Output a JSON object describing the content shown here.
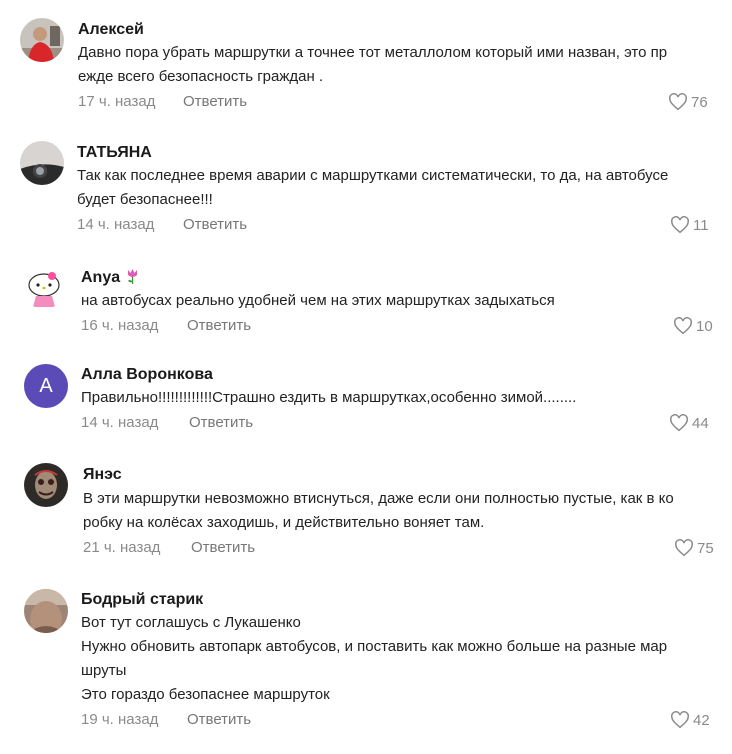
{
  "reply_label": "Ответить",
  "comments": [
    {
      "author": "Алексей",
      "lines": [
        "Давно пора убрать маршрутки а точнее тот металлолом который ими назван, это пр",
        "ежде всего безопасность граждан ."
      ],
      "time": "17 ч. назад",
      "likes": "76"
    },
    {
      "author": "ТАТЬЯНА",
      "lines": [
        "Так как последнее время аварии с маршрутками систематически, то да, на автобусе",
        "будет безопаснее!!!"
      ],
      "time": "14 ч. назад",
      "likes": "11"
    },
    {
      "author": "Anya",
      "lines": [
        "на автобусах реально удобней чем на этих маршрутках задыхаться"
      ],
      "time": "16 ч. назад",
      "likes": "10"
    },
    {
      "author": "Алла Воронкова",
      "avatar_letter": "A",
      "lines": [
        "Правильно!!!!!!!!!!!!!Страшно ездить в маршрутках,особенно зимой........"
      ],
      "time": "14 ч. назад",
      "likes": "44"
    },
    {
      "author": "Янэс",
      "lines": [
        "В эти маршрутки невозможно втиснуться, даже если они полностью пустые, как в ко",
        "робку на колёсах заходишь, и действительно воняет там."
      ],
      "time": "21 ч. назад",
      "likes": "75"
    },
    {
      "author": "Бодрый старик",
      "lines": [
        "Вот тут соглашусь с Лукашенко",
        "Нужно обновить автопарк автобусов, и поставить как можно больше на разные мар",
        "шруты",
        "Это гораздо безопаснее маршруток"
      ],
      "time": "19 ч. назад",
      "likes": "42"
    }
  ],
  "colors": {
    "letter_avatar": "#5b4bb7",
    "meta_text": "#8a8a8a"
  }
}
